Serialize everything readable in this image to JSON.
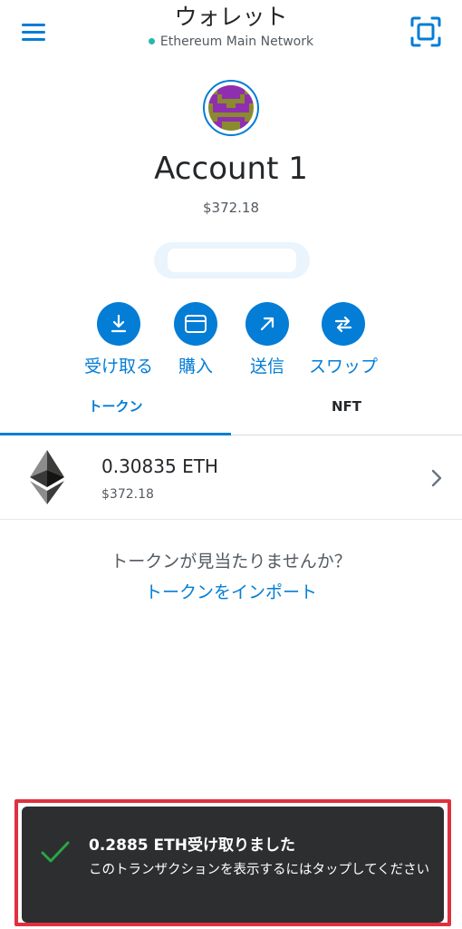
{
  "header": {
    "title": "ウォレット",
    "network": "Ethereum Main Network",
    "network_dot_color": "#29b6af"
  },
  "account": {
    "name": "Account 1",
    "balance": "$372.18"
  },
  "actions": [
    {
      "label": "受け取る",
      "icon": "receive-arrow-down-icon"
    },
    {
      "label": "購入",
      "icon": "card-icon"
    },
    {
      "label": "送信",
      "icon": "send-arrow-up-right-icon"
    },
    {
      "label": "スワップ",
      "icon": "swap-arrows-icon"
    }
  ],
  "tabs": [
    {
      "label": "トークン",
      "active": true
    },
    {
      "label": "NFT",
      "active": false
    }
  ],
  "tokens": [
    {
      "amount": "0.30835 ETH",
      "fiat": "$372.18",
      "icon": "ethereum-logo-icon"
    }
  ],
  "import": {
    "question": "トークンが見当たりませんか？",
    "link": "トークンをインポート"
  },
  "toast": {
    "title": "0.2885 ETH受け取りました",
    "message": "このトランザクションを表示するにはタップしてください"
  },
  "colors": {
    "accent": "#037dd6",
    "toast_bg": "#2d2e30",
    "highlight_frame": "#e0303f",
    "success": "#28a745"
  }
}
